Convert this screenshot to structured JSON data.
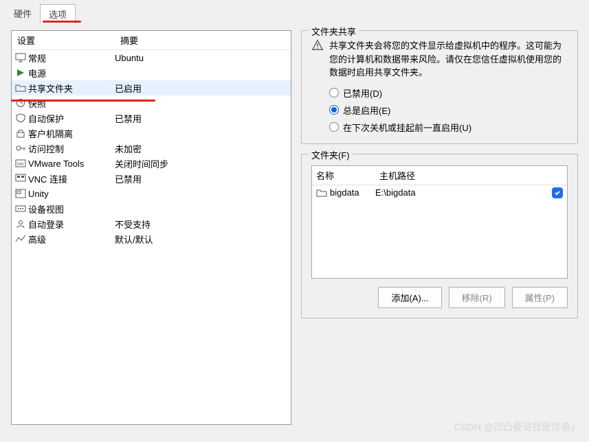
{
  "tabs": {
    "hardware": "硬件",
    "options": "选项"
  },
  "left": {
    "header_settings": "设置",
    "header_summary": "摘要",
    "rows": [
      {
        "label": "常规",
        "summary": "Ubuntu",
        "icon": "monitor"
      },
      {
        "label": "电源",
        "summary": "",
        "icon": "play"
      },
      {
        "label": "共享文件夹",
        "summary": "已启用",
        "icon": "folder",
        "selected": true
      },
      {
        "label": "快照",
        "summary": "",
        "icon": "clock"
      },
      {
        "label": "自动保护",
        "summary": "已禁用",
        "icon": "shield"
      },
      {
        "label": "客户机隔离",
        "summary": "",
        "icon": "lock"
      },
      {
        "label": "访问控制",
        "summary": "未加密",
        "icon": "key"
      },
      {
        "label": "VMware Tools",
        "summary": "关闭时间同步",
        "icon": "vm"
      },
      {
        "label": "VNC 连接",
        "summary": "已禁用",
        "icon": "vnc"
      },
      {
        "label": "Unity",
        "summary": "",
        "icon": "unity"
      },
      {
        "label": "设备视图",
        "summary": "",
        "icon": "device"
      },
      {
        "label": "自动登录",
        "summary": "不受支持",
        "icon": "login"
      },
      {
        "label": "高级",
        "summary": "默认/默认",
        "icon": "advanced"
      }
    ]
  },
  "share_group": {
    "title": "文件夹共享",
    "warning": "共享文件夹会将您的文件显示给虚拟机中的程序。这可能为您的计算机和数据带来风险。请仅在您信任虚拟机使用您的数据时启用共享文件夹。",
    "radio_disabled": "已禁用(D)",
    "radio_always": "总是启用(E)",
    "radio_until": "在下次关机或挂起前一直启用(U)"
  },
  "folders_group": {
    "title": "文件夹(F)",
    "col_name": "名称",
    "col_path": "主机路径",
    "rows": [
      {
        "name": "bigdata",
        "path": "E:\\bigdata",
        "checked": true
      }
    ],
    "btn_add": "添加(A)...",
    "btn_remove": "移除(R)",
    "btn_props": "属性(P)"
  },
  "watermark": "CSDN @凹凸曼说我是怪兽y"
}
